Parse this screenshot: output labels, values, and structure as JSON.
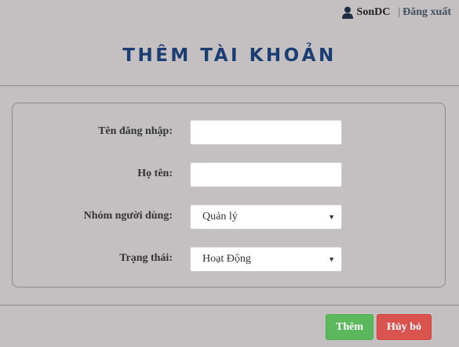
{
  "header": {
    "username": "SonDC",
    "separator": "|",
    "logout_label": "Đăng xuất"
  },
  "page": {
    "title": "THÊM TÀI KHOẢN"
  },
  "form": {
    "username_label": "Tên đăng nhập:",
    "username_value": "",
    "fullname_label": "Họ tên:",
    "fullname_value": "",
    "group_label": "Nhóm người dùng:",
    "group_value": "Quản lý",
    "status_label": "Trạng thái:",
    "status_value": "Hoạt Động"
  },
  "actions": {
    "add_label": "Thêm",
    "cancel_label": "Hủy bỏ"
  },
  "colors": {
    "background": "#c4c0c1",
    "title": "#1a3d73",
    "add_button": "#5cb85c",
    "cancel_button": "#d9534f"
  }
}
